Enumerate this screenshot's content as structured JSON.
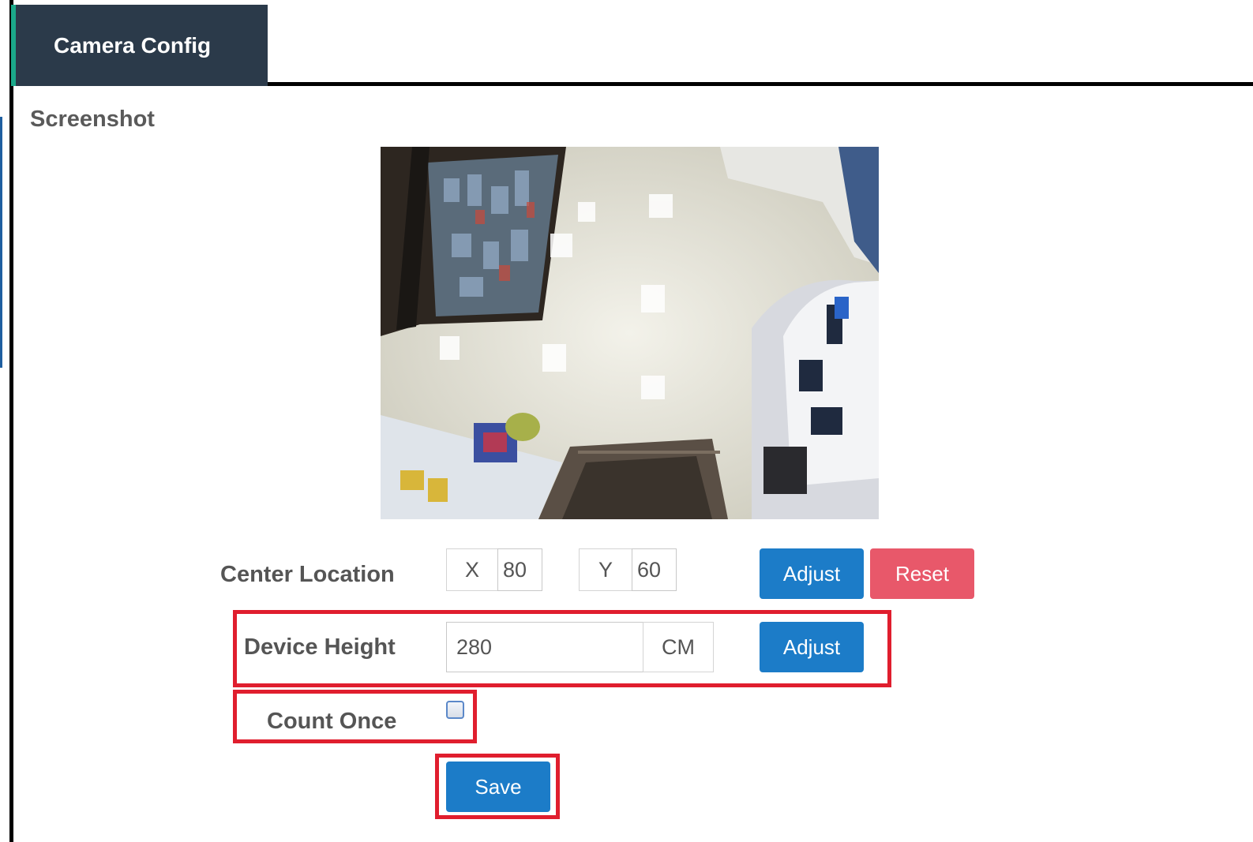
{
  "header": {
    "tab_title": "Camera Config"
  },
  "screenshot": {
    "section_title": "Screenshot"
  },
  "center_location": {
    "label": "Center Location",
    "x_label": "X",
    "x_value": "80",
    "y_label": "Y",
    "y_value": "60",
    "adjust_label": "Adjust",
    "reset_label": "Reset"
  },
  "device_height": {
    "label": "Device Height",
    "value": "280",
    "unit": "CM",
    "adjust_label": "Adjust"
  },
  "count_once": {
    "label": "Count Once",
    "checked": false
  },
  "save_label": "Save",
  "colors": {
    "tab_bg": "#2b3a4a",
    "tab_accent": "#1ba98a",
    "primary": "#1c7cc8",
    "danger": "#e8586a",
    "highlight": "#e01e2e"
  }
}
